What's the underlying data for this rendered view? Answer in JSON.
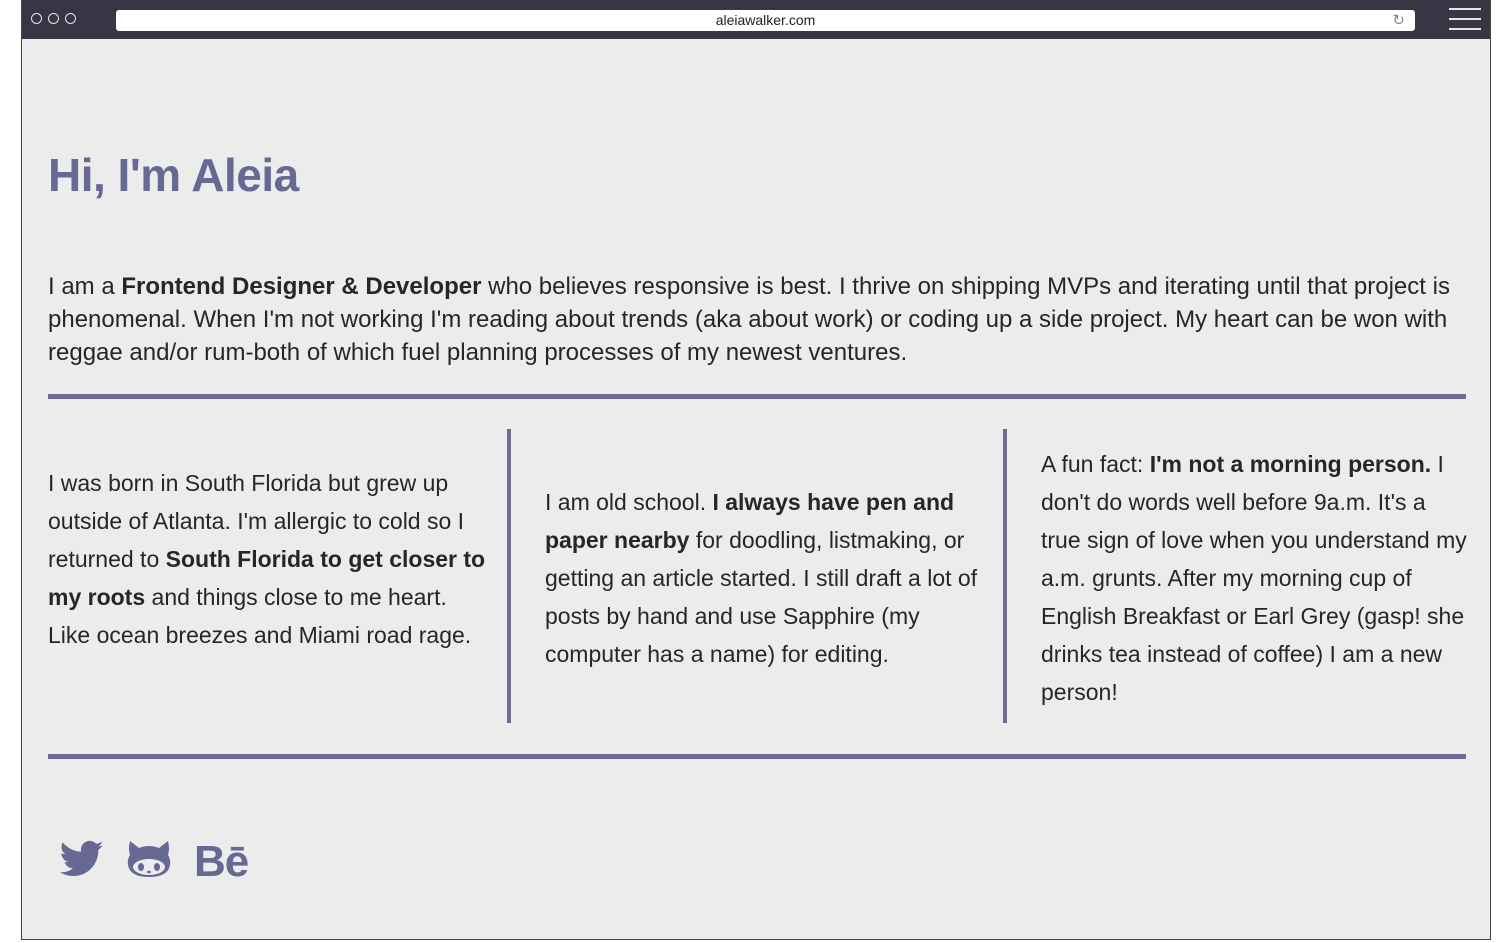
{
  "browser": {
    "url": "aleiawalker.com"
  },
  "page": {
    "heading": "Hi, I'm Aleia",
    "intro": {
      "pre": "I am a ",
      "bold": "Frontend Designer & Developer",
      "post": " who believes responsive is best. I thrive on shipping MVPs and iterating until that project is phenomenal. When I'm not working I'm reading about trends (aka about work) or coding up a side project. My heart can be won with reggae and/or rum-both of which fuel planning processes of my newest ventures."
    },
    "columns": [
      {
        "pre": "I was born in South Florida but grew up outside of Atlanta. I'm allergic to cold so I returned to ",
        "bold": "South Florida to get closer to my roots",
        "post": " and things close to me heart. Like ocean breezes and Miami road rage."
      },
      {
        "pre": "I am old school. ",
        "bold": "I always have pen and paper nearby",
        "post": " for doodling, listmaking, or getting an article started. I still draft a lot of posts by hand and use Sapphire (my computer has a name) for editing."
      },
      {
        "pre": "A fun fact: ",
        "bold": "I'm not a morning person.",
        "post": " I don't do words well before 9a.m. It's a true sign of love when you understand my a.m. grunts. After my morning cup of English Breakfast or Earl Grey (gasp! she drinks tea instead of coffee) I am a new person!"
      }
    ],
    "social": {
      "behance_label": "Bē",
      "icons": [
        "twitter-icon",
        "github-icon",
        "behance-icon"
      ]
    },
    "colors": {
      "accent": "#676893",
      "rule": "#6d6d96",
      "background": "#ececec",
      "titlebar": "#373645"
    }
  }
}
